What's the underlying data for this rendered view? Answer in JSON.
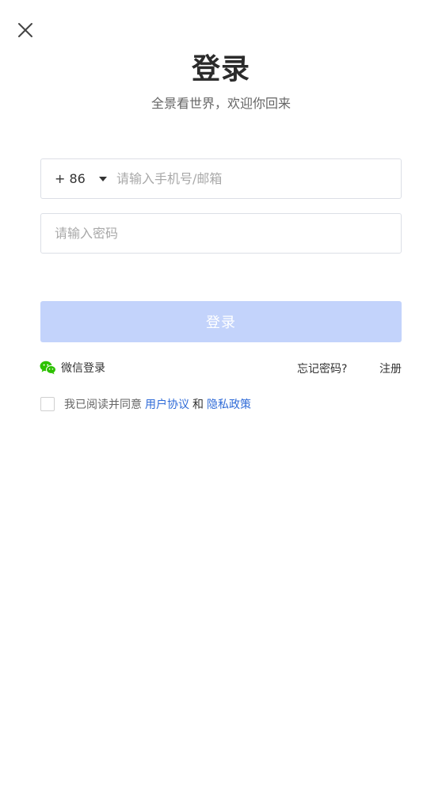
{
  "header": {
    "title": "登录",
    "subtitle": "全景看世界，欢迎你回来"
  },
  "form": {
    "country_code": "+ 86",
    "phone_placeholder": "请输入手机号/邮箱",
    "password_placeholder": "请输入密码",
    "submit_label": "登录"
  },
  "options": {
    "wechat_label": "微信登录",
    "forgot_label": "忘记密码?",
    "register_label": "注册"
  },
  "agreement": {
    "prefix": "我已阅读并同意",
    "user_agreement": "用户协议",
    "joiner": "和",
    "privacy_policy": "隐私政策",
    "checked": false
  },
  "icons": {
    "close": "close-icon",
    "caret": "caret-down-icon",
    "wechat": "wechat-icon"
  },
  "colors": {
    "primary_disabled": "#c3d3fb",
    "link": "#2f6bd8",
    "wechat": "#2dc100"
  }
}
